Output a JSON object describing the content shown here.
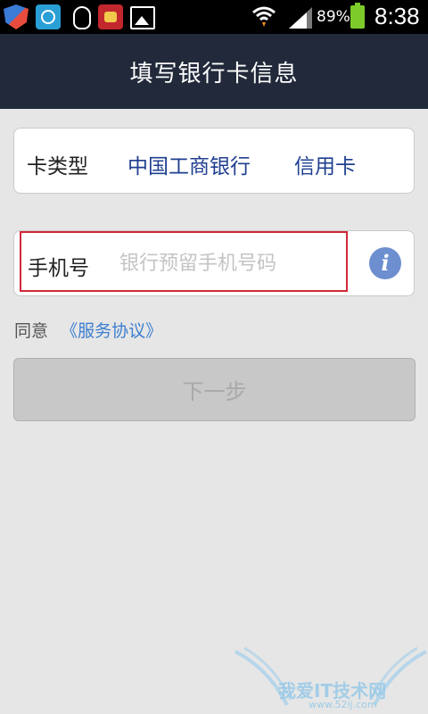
{
  "status_bar": {
    "battery_percent": "89%",
    "time": "8:38",
    "icons": [
      "shield-app-icon",
      "clock-app-icon",
      "qq-icon",
      "ox-app-icon",
      "gallery-icon",
      "wifi-icon",
      "signal-icon",
      "battery-icon"
    ]
  },
  "header": {
    "title": "填写银行卡信息"
  },
  "card_type": {
    "label": "卡类型",
    "bank": "中国工商银行",
    "kind": "信用卡"
  },
  "phone": {
    "label": "手机号",
    "value": "",
    "placeholder": "银行预留手机号码",
    "info_icon": "i"
  },
  "agreement": {
    "prefix": "同意",
    "link": "《服务协议》"
  },
  "next_button": {
    "label": "下一步",
    "enabled": false
  },
  "watermark": {
    "text": "我爱IT技术网",
    "sub": "www.52ij.com"
  },
  "colors": {
    "header_bg": "#21293a",
    "accent_blue": "#1f3f8f",
    "link_blue": "#3d7fd0",
    "highlight_red": "#d0283a",
    "info_icon": "#6d8fd0"
  }
}
